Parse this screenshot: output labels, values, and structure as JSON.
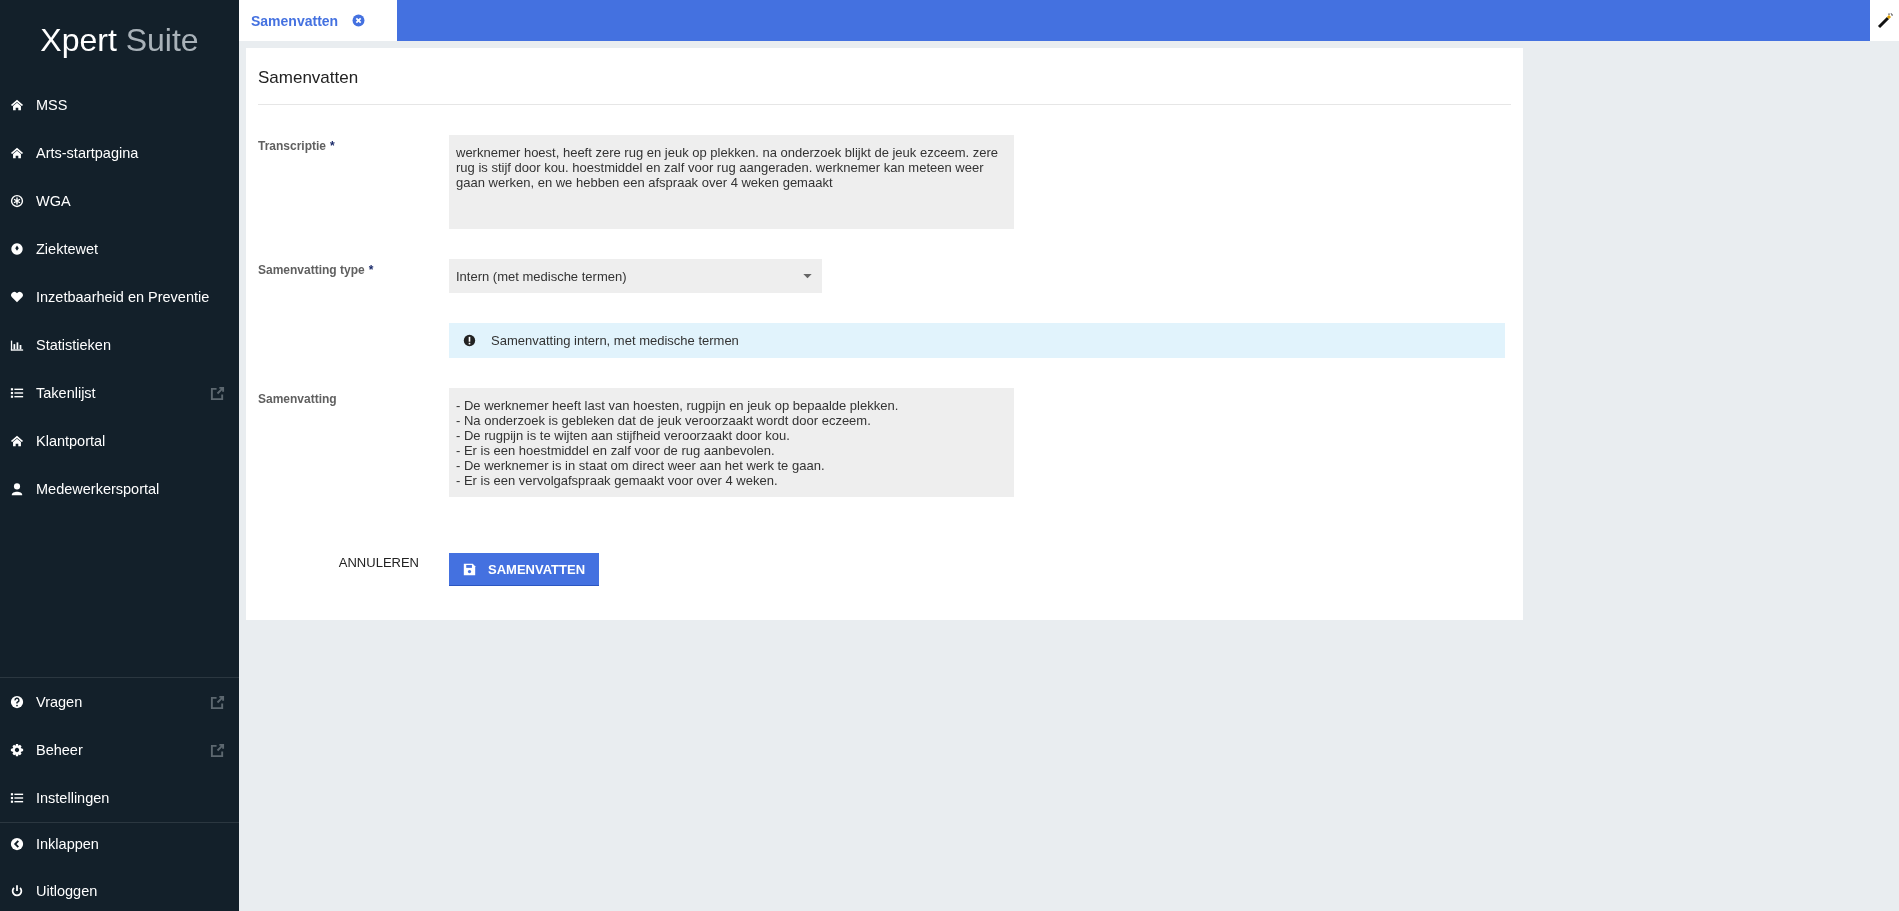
{
  "brand": {
    "first": "Xpert",
    "second": "Suite"
  },
  "sidebar": {
    "items": [
      {
        "label": "MSS",
        "external": false
      },
      {
        "label": "Arts-startpagina",
        "external": false
      },
      {
        "label": "WGA",
        "external": false
      },
      {
        "label": "Ziektewet",
        "external": false
      },
      {
        "label": "Inzetbaarheid en Preventie",
        "external": false
      },
      {
        "label": "Statistieken",
        "external": false
      },
      {
        "label": "Takenlijst",
        "external": true
      },
      {
        "label": "Klantportal",
        "external": false
      },
      {
        "label": "Medewerkersportal",
        "external": false
      }
    ],
    "bottom_items": [
      {
        "label": "Vragen",
        "external": true
      },
      {
        "label": "Beheer",
        "external": true
      },
      {
        "label": "Instellingen",
        "external": false
      }
    ],
    "footer_items": [
      {
        "label": "Inklappen",
        "external": false
      },
      {
        "label": "Uitloggen",
        "external": false
      }
    ]
  },
  "tabs": [
    {
      "label": "Samenvatten",
      "selected": true
    }
  ],
  "card": {
    "title": "Samenvatten",
    "fields": [
      {
        "kind": "textarea",
        "label": "Transcriptie",
        "required_mark": "*",
        "value": "werknemer hoest, heeft zere rug en jeuk op plekken. na onderzoek blijkt de jeuk ezceem. zere rug is stijf door kou. hoestmiddel en zalf voor rug aangeraden. werknemer kan meteen weer gaan werken, en we hebben een afspraak over 4 weken gemaakt"
      },
      {
        "kind": "select",
        "label": "Samenvatting type",
        "required_mark": "*",
        "value": "Intern (met medische termen)"
      },
      {
        "kind": "info",
        "text": "Samenvatting intern, met medische termen"
      },
      {
        "kind": "output",
        "label": "Samenvatting",
        "lines": [
          "- De werknemer heeft last van hoesten, rugpijn en jeuk op bepaalde plekken.",
          "- Na onderzoek is gebleken dat de jeuk veroorzaakt wordt door eczeem.",
          "- De rugpijn is te wijten aan stijfheid veroorzaakt door kou.",
          "- Er is een hoestmiddel en zalf voor de rug aanbevolen.",
          "- De werknemer is in staat om direct weer aan het werk te gaan.",
          "- Er is een vervolgafspraak gemaakt voor over 4 weken."
        ]
      }
    ],
    "cancel": "ANNULEREN",
    "submit": "SAMENVATTEN"
  }
}
